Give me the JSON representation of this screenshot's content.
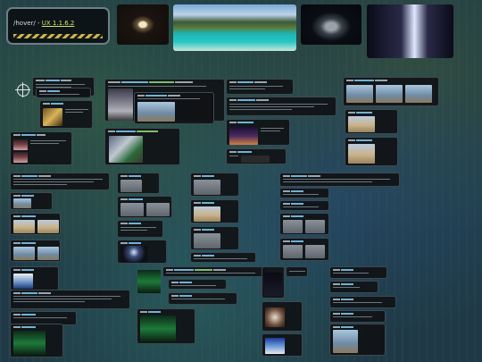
{
  "header": {
    "prefix": "/hover/ - ",
    "links": [
      "UX 1.1.6.2"
    ],
    "title": "/hover/ - UX 1.1.6.2"
  },
  "thumbnails": [
    {
      "name": "ufo-thumbnail",
      "style": "radial"
    },
    {
      "name": "lagoon-thumbnail",
      "style": "lagoon"
    },
    {
      "name": "ship-thumbnail",
      "style": "ship"
    },
    {
      "name": "alien-thumbnail",
      "style": "alien"
    }
  ],
  "colors": {
    "accent": "#cfe66a",
    "link": "#6fb3d6",
    "card": "#101216",
    "border": "#3c4a52"
  }
}
